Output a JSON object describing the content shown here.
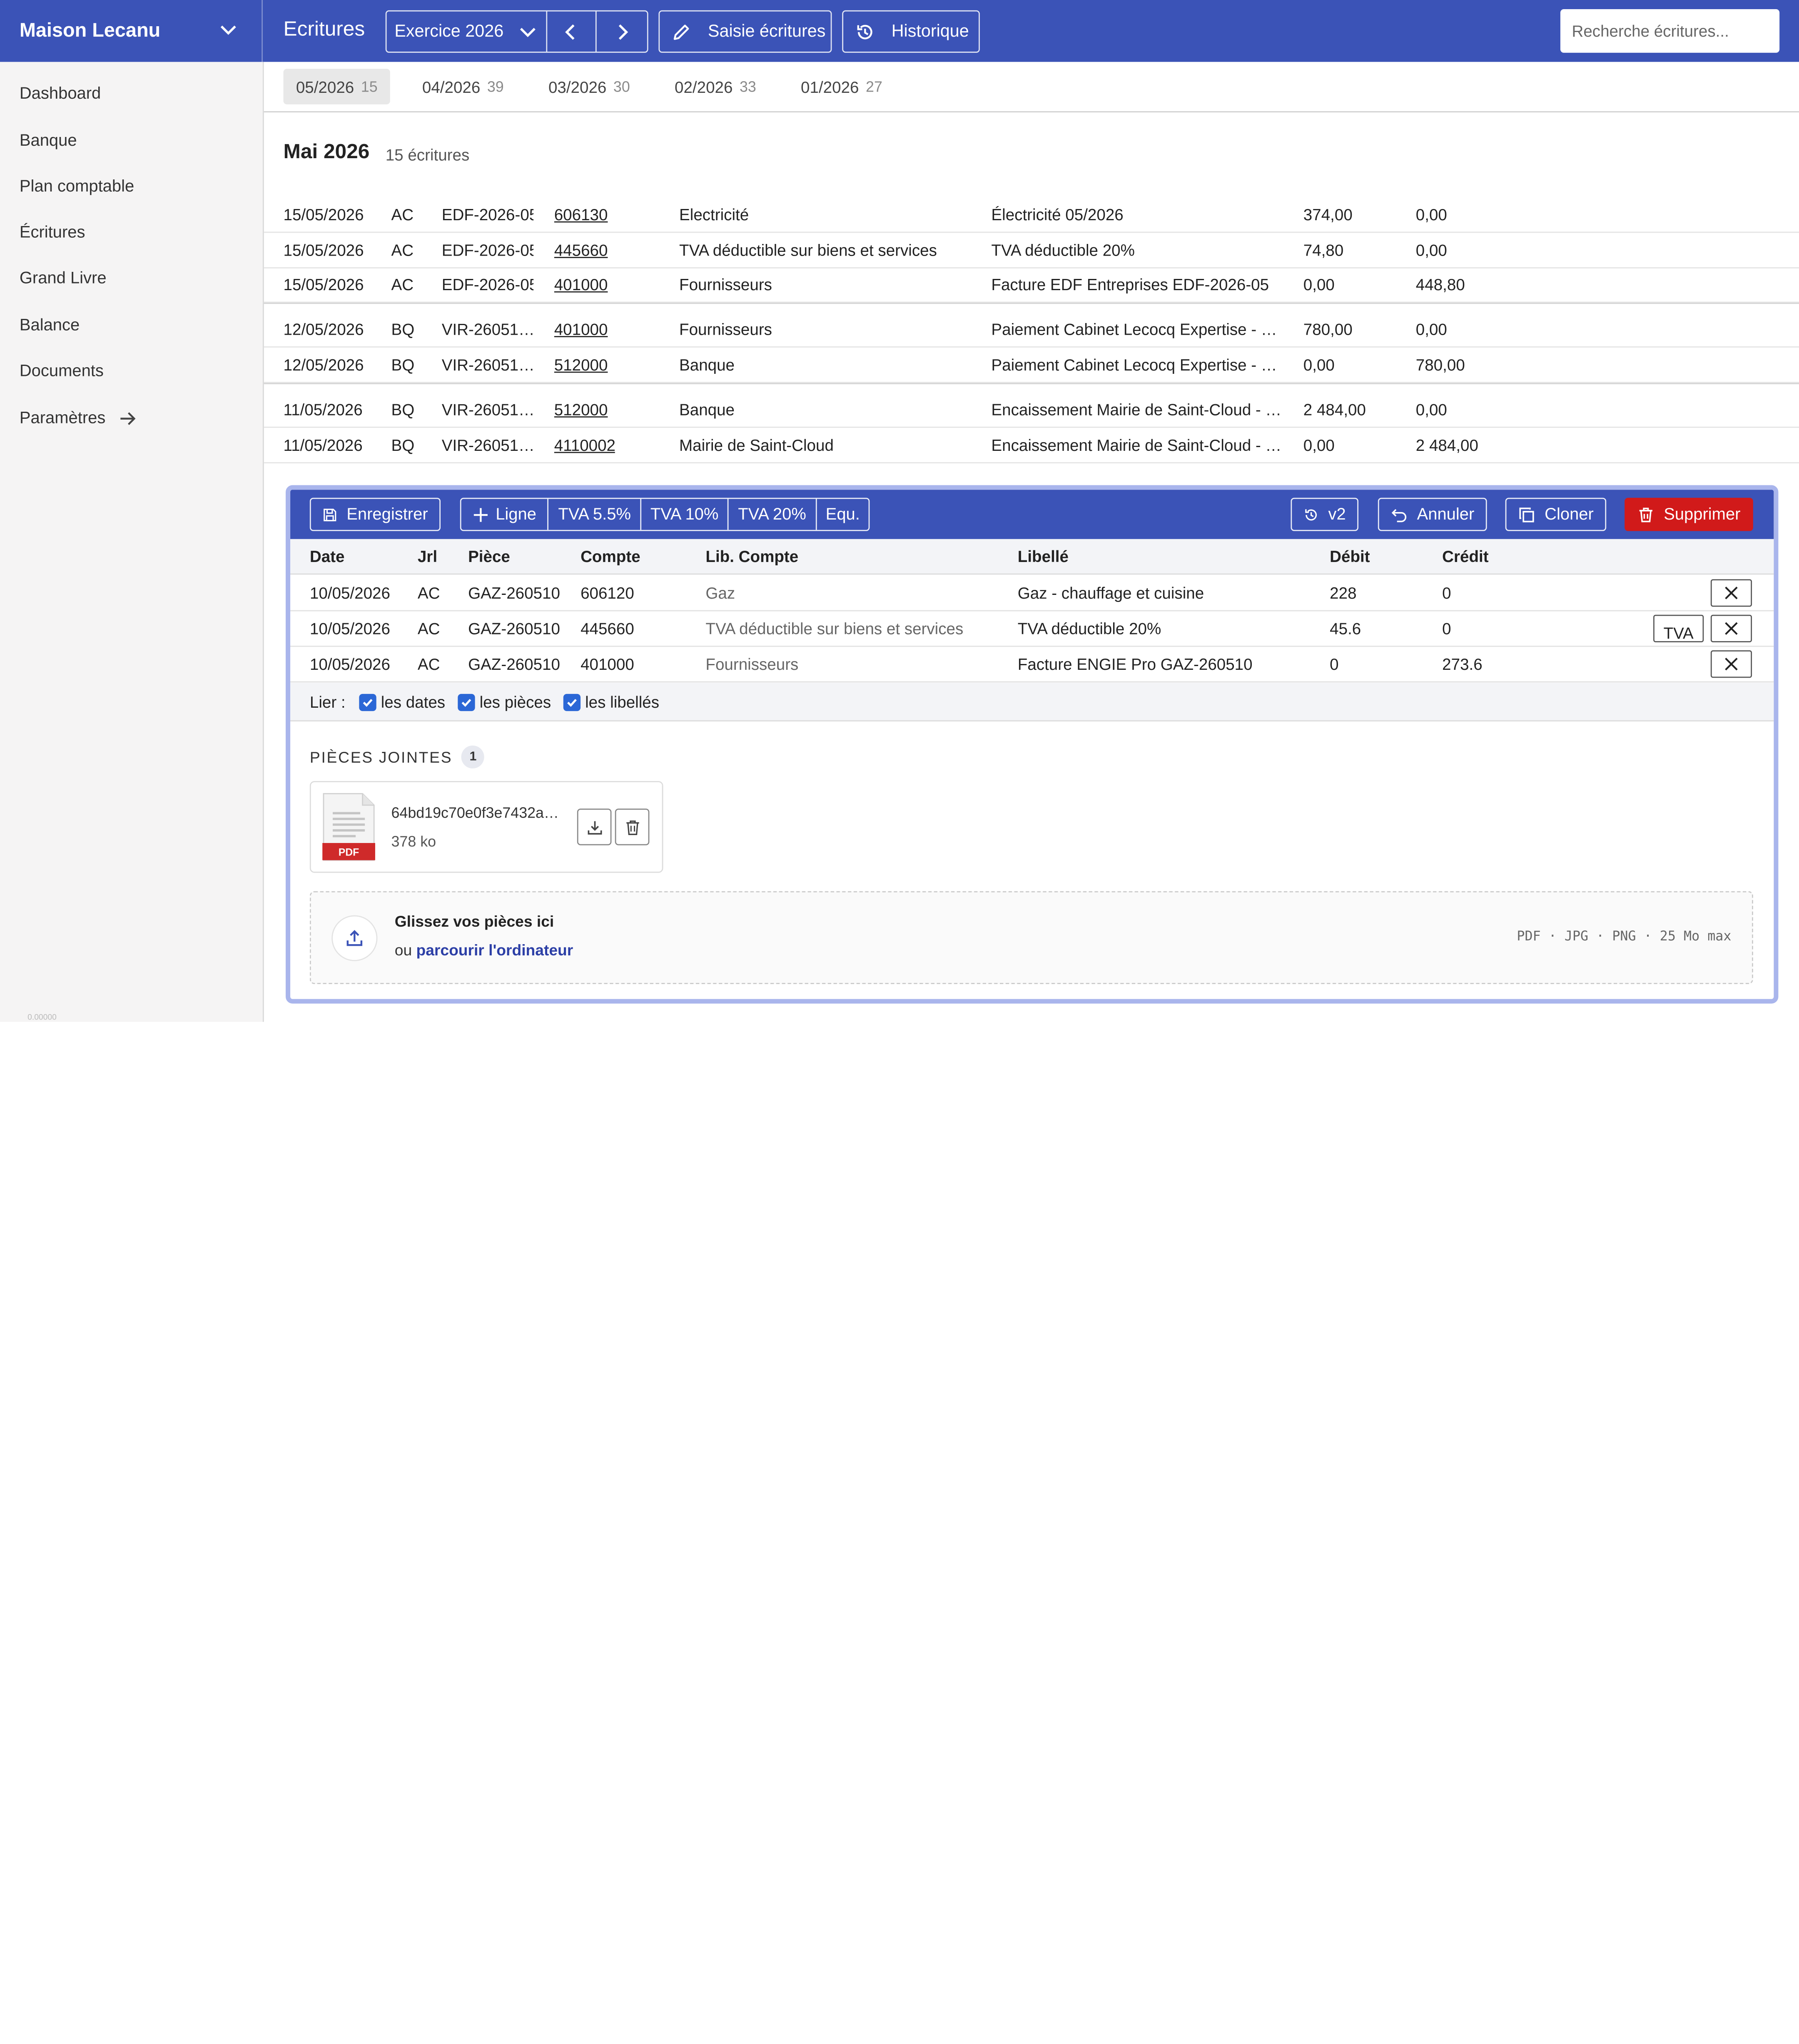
{
  "app": {
    "brand": "Maison Lecanu",
    "section": "Ecritures"
  },
  "toolbar": {
    "exercice_label": "Exercice 2026",
    "saisie_label": "Saisie écritures",
    "historique_label": "Historique",
    "search_placeholder": "Recherche écritures..."
  },
  "sidebar": {
    "items": [
      {
        "label": "Dashboard"
      },
      {
        "label": "Banque"
      },
      {
        "label": "Plan comptable"
      },
      {
        "label": "Écritures"
      },
      {
        "label": "Grand Livre"
      },
      {
        "label": "Balance"
      },
      {
        "label": "Documents"
      },
      {
        "label": "Paramètres"
      }
    ],
    "version": "0.00000"
  },
  "periods": [
    {
      "label": "05/2026",
      "count": "15",
      "active": true
    },
    {
      "label": "04/2026",
      "count": "39"
    },
    {
      "label": "03/2026",
      "count": "30"
    },
    {
      "label": "02/2026",
      "count": "33"
    },
    {
      "label": "01/2026",
      "count": "27"
    }
  ],
  "month": {
    "title": "Mai 2026",
    "count": "15 écritures"
  },
  "entries": [
    {
      "date": "15/05/2026",
      "jrl": "AC",
      "piece": "EDF-2026-05",
      "compte": "606130",
      "lib_compte": "Electricité",
      "libelle": "Électricité 05/2026",
      "debit": "374,00",
      "credit": "0,00"
    },
    {
      "date": "15/05/2026",
      "jrl": "AC",
      "piece": "EDF-2026-05",
      "compte": "445660",
      "lib_compte": "TVA déductible sur biens et services",
      "libelle": "TVA déductible 20%",
      "debit": "74,80",
      "credit": "0,00"
    },
    {
      "date": "15/05/2026",
      "jrl": "AC",
      "piece": "EDF-2026-05",
      "compte": "401000",
      "lib_compte": "Fournisseurs",
      "libelle": "Facture EDF Entreprises EDF-2026-05",
      "debit": "0,00",
      "credit": "448,80"
    },
    {
      "date": "12/05/2026",
      "jrl": "BQ",
      "piece": "VIR-26051…",
      "compte": "401000",
      "lib_compte": "Fournisseurs",
      "libelle": "Paiement Cabinet Lecocq Expertise - …",
      "debit": "780,00",
      "credit": "0,00"
    },
    {
      "date": "12/05/2026",
      "jrl": "BQ",
      "piece": "VIR-26051…",
      "compte": "512000",
      "lib_compte": "Banque",
      "libelle": "Paiement Cabinet Lecocq Expertise - …",
      "debit": "0,00",
      "credit": "780,00"
    },
    {
      "date": "11/05/2026",
      "jrl": "BQ",
      "piece": "VIR-26051…",
      "compte": "512000",
      "lib_compte": "Banque",
      "libelle": "Encaissement Mairie de Saint-Cloud - …",
      "debit": "2 484,00",
      "credit": "0,00"
    },
    {
      "date": "11/05/2026",
      "jrl": "BQ",
      "piece": "VIR-26051…",
      "compte": "4110002",
      "lib_compte": "Mairie de Saint-Cloud",
      "libelle": "Encaissement Mairie de Saint-Cloud - …",
      "debit": "0,00",
      "credit": "2 484,00"
    }
  ],
  "editor": {
    "save_label": "Enregistrer",
    "add_line_label": "Ligne",
    "tva1": "TVA 5.5%",
    "tva2": "TVA 10%",
    "tva3": "TVA 20%",
    "equ": "Equ.",
    "version_label": "v2",
    "cancel_label": "Annuler",
    "clone_label": "Cloner",
    "delete_label": "Supprimer",
    "headers": {
      "date": "Date",
      "jrl": "Jrl",
      "piece": "Pièce",
      "compte": "Compte",
      "lib_compte": "Lib. Compte",
      "libelle": "Libellé",
      "debit": "Débit",
      "credit": "Crédit"
    },
    "rows": [
      {
        "date": "10/05/2026",
        "jrl": "AC",
        "piece": "GAZ-260510",
        "compte": "606120",
        "lib_compte": "Gaz",
        "libelle": "Gaz - chauffage et cuisine",
        "debit": "228",
        "credit": "0"
      },
      {
        "date": "10/05/2026",
        "jrl": "AC",
        "piece": "GAZ-260510",
        "compte": "445660",
        "lib_compte": "TVA déductible sur biens et services",
        "libelle": "TVA déductible 20%",
        "debit": "45.6",
        "credit": "0",
        "tva_btn": "TVA"
      },
      {
        "date": "10/05/2026",
        "jrl": "AC",
        "piece": "GAZ-260510",
        "compte": "401000",
        "lib_compte": "Fournisseurs",
        "libelle": "Facture ENGIE Pro GAZ-260510",
        "debit": "0",
        "credit": "273.6"
      }
    ],
    "link": {
      "label": "Lier :",
      "dates": "les dates",
      "pieces": "les pièces",
      "libelles": "les libellés"
    },
    "attachments": {
      "title": "PIÈCES JOINTES",
      "count": "1",
      "file": {
        "name": "64bd19c70e0f3e7432a…",
        "size": "378  ko",
        "type": "PDF"
      }
    },
    "dropzone": {
      "title": "Glissez vos pièces ici",
      "prefix": "ou ",
      "link": "parcourir l'ordinateur",
      "formats": "PDF · JPG · PNG · 25 Mo max"
    }
  },
  "colors": {
    "primary": "#3b53b7",
    "danger": "#d11a1a",
    "panel_border": "#a9b5ec",
    "checkbox": "#2b67d6"
  }
}
